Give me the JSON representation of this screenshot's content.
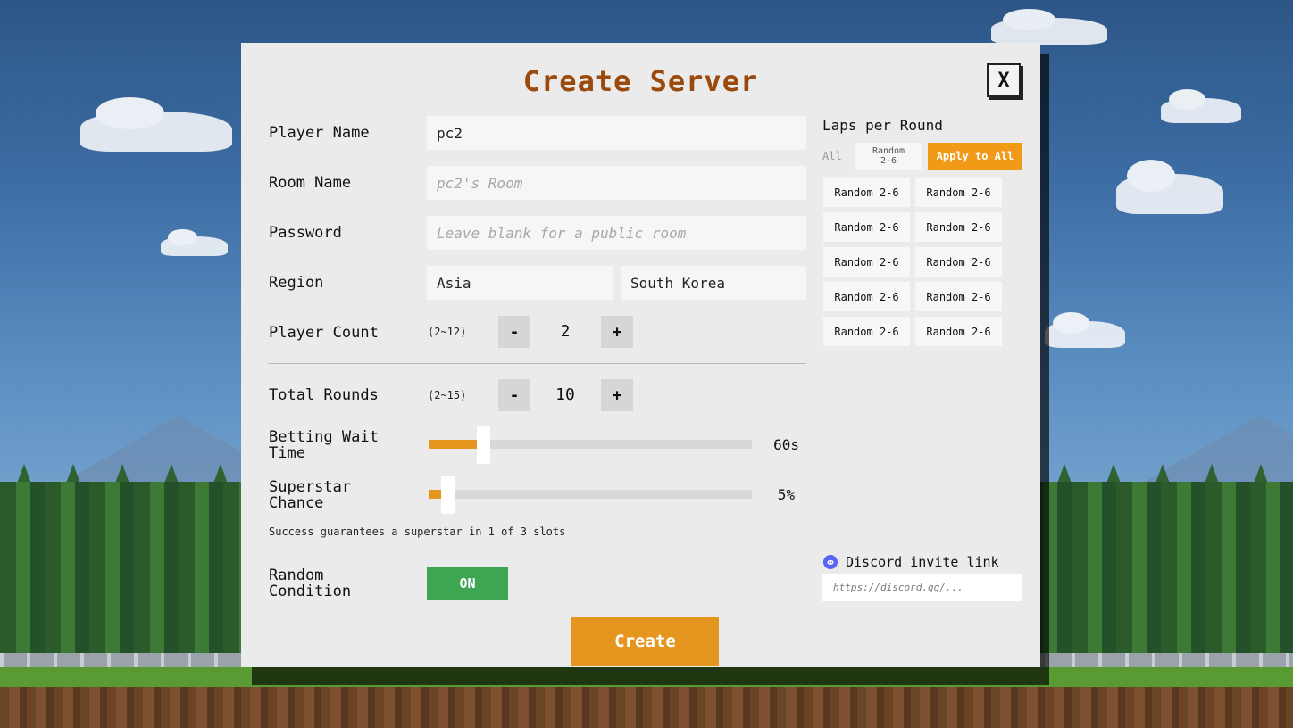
{
  "colors": {
    "title": "#9a4a0c",
    "accent_orange": "#e4961f",
    "toggle_green": "#3ea553",
    "discord_blue": "#5865f2"
  },
  "dialog": {
    "title": "Create Server",
    "close_label": "X"
  },
  "form": {
    "player_name": {
      "label": "Player Name",
      "value": "pc2"
    },
    "room_name": {
      "label": "Room Name",
      "placeholder": "pc2's Room"
    },
    "password": {
      "label": "Password",
      "placeholder": "Leave blank for a public room"
    },
    "region": {
      "label": "Region",
      "continent": "Asia",
      "country": "South Korea"
    },
    "player_count": {
      "label": "Player Count",
      "range": "(2~12)",
      "value": "2",
      "minus": "-",
      "plus": "+"
    },
    "total_rounds": {
      "label": "Total Rounds",
      "range": "(2~15)",
      "value": "10",
      "minus": "-",
      "plus": "+"
    },
    "betting_wait": {
      "label_line1": "Betting Wait",
      "label_line2": "Time",
      "display": "60s",
      "fraction": 0.16
    },
    "superstar": {
      "label_line1": "Superstar",
      "label_line2": "Chance",
      "display": "5%",
      "fraction": 0.05
    },
    "superstar_note": "Success guarantees a superstar in 1 of 3 slots",
    "random_condition": {
      "label_line1": "Random",
      "label_line2": "Condition",
      "toggle": "ON"
    },
    "create_label": "Create"
  },
  "laps": {
    "title": "Laps per Round",
    "all_label": "All",
    "random_chip_line1": "Random",
    "random_chip_line2": "2-6",
    "apply_label": "Apply to All",
    "cells": [
      "Random 2-6",
      "Random 2-6",
      "Random 2-6",
      "Random 2-6",
      "Random 2-6",
      "Random 2-6",
      "Random 2-6",
      "Random 2-6",
      "Random 2-6",
      "Random 2-6"
    ]
  },
  "discord": {
    "label": "Discord invite link",
    "placeholder": "https://discord.gg/..."
  }
}
